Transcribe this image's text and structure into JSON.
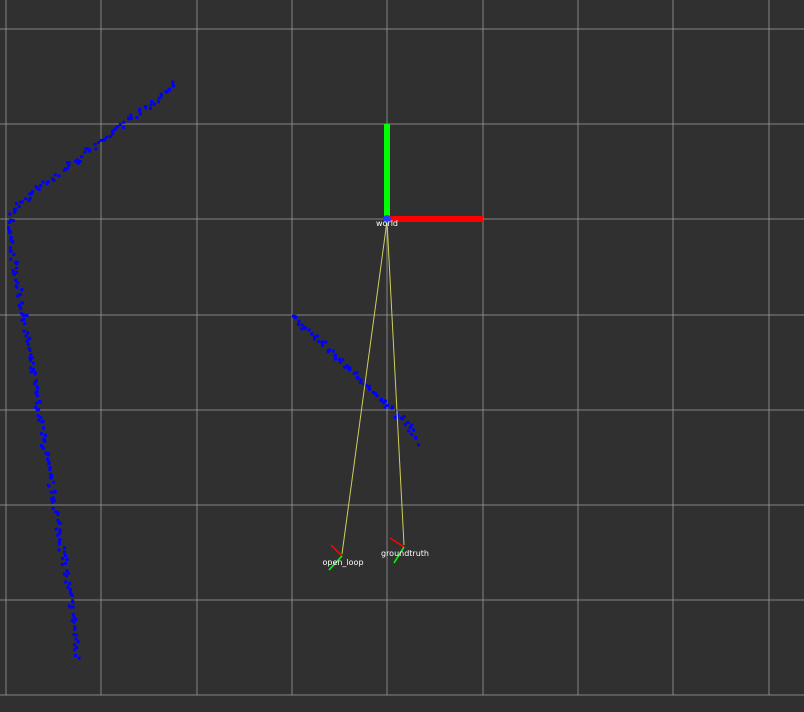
{
  "viewport": {
    "background_color": "#303030",
    "grid_color": "#a0a0a0"
  },
  "frames": {
    "world": {
      "label": "world"
    },
    "open_loop": {
      "label": "open_loop"
    },
    "ground_truth": {
      "label": "groundtruth"
    }
  },
  "colors": {
    "x_axis": "#ff0000",
    "y_axis": "#00ff00",
    "points": "#0000ff",
    "tf_link": "#cfcf5a",
    "label_text": "#ffffff"
  },
  "point_clouds": {
    "left_wall": {
      "icon": "laser-scan-points"
    },
    "center_wall": {
      "icon": "laser-scan-points"
    }
  }
}
